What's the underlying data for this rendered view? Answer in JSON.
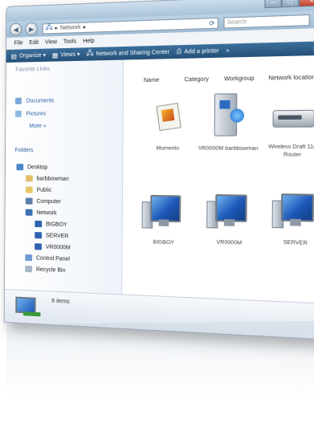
{
  "window": {
    "title_buttons": {
      "minimize": "–",
      "maximize": "□",
      "close": "×"
    }
  },
  "navbar": {
    "back": "◀",
    "forward": "▶",
    "address": {
      "root_icon": "network-icon",
      "text": "Network",
      "separator": "▸"
    },
    "refresh": "⟳",
    "search_placeholder": "Search"
  },
  "menubar": {
    "items": [
      "File",
      "Edit",
      "View",
      "Tools",
      "Help"
    ]
  },
  "toolbar": {
    "organize": "Organize",
    "views": "Views",
    "network_center": "Network and Sharing Center",
    "add_printer": "Add a printer",
    "more": "»",
    "help": "?"
  },
  "sidebar": {
    "favorite_links": "Favorite Links",
    "favorites": [
      "Documents",
      "Pictures"
    ],
    "more": "More »",
    "folders": "Folders",
    "tree": [
      {
        "label": "Desktop",
        "icon": "desktop-icon"
      },
      {
        "label": "barbbowman",
        "icon": "user-folder-icon"
      },
      {
        "label": "Public",
        "icon": "folder-icon"
      },
      {
        "label": "Computer",
        "icon": "computer-icon"
      },
      {
        "label": "Network",
        "icon": "network-icon"
      },
      {
        "label": "BIGBOY",
        "icon": "computer-icon"
      },
      {
        "label": "SERVER",
        "icon": "computer-icon"
      },
      {
        "label": "VR0000M",
        "icon": "computer-icon"
      },
      {
        "label": "Control Panel",
        "icon": "control-panel-icon"
      },
      {
        "label": "Recycle Bin",
        "icon": "recycle-bin-icon"
      }
    ]
  },
  "content": {
    "columns": [
      "Name",
      "Category",
      "Workgroup",
      "Network location"
    ],
    "items": [
      {
        "label": "Momento",
        "icon": "media-device-icon"
      },
      {
        "label": "VR0000M barbbowman",
        "icon": "media-server-icon"
      },
      {
        "label": "Wireless Draft 11n Router",
        "icon": "router-icon"
      },
      {
        "label": "BIGBOY",
        "icon": "computer-icon"
      },
      {
        "label": "VR0000M",
        "icon": "computer-icon"
      },
      {
        "label": "SERVER",
        "icon": "computer-icon"
      }
    ]
  },
  "details": {
    "count": "6 items"
  },
  "colors": {
    "toolbar": "#245078",
    "link": "#2d64a8",
    "screen": "#1d57b8"
  }
}
